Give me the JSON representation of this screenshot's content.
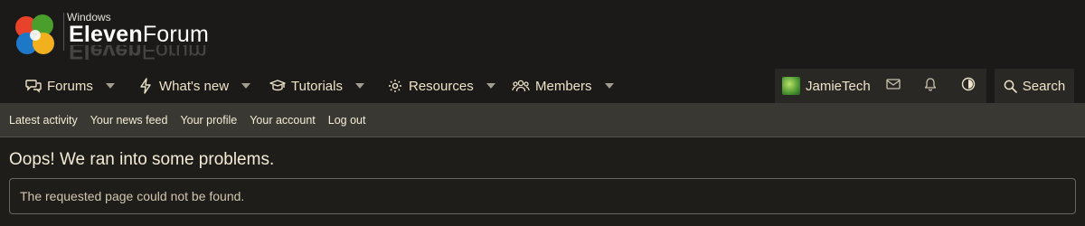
{
  "brand": {
    "pretitle": "Windows",
    "title_bold": "Eleven",
    "title_regular": "Forum"
  },
  "nav": {
    "items": [
      {
        "label": "Forums",
        "icon": "forums-icon"
      },
      {
        "label": "What's new",
        "icon": "bolt-icon"
      },
      {
        "label": "Tutorials",
        "icon": "graduation-cap-icon"
      },
      {
        "label": "Resources",
        "icon": "gear-icon"
      },
      {
        "label": "Members",
        "icon": "members-icon"
      }
    ],
    "user": {
      "name": "JamieTech"
    },
    "search_label": "Search"
  },
  "subnav": {
    "links": [
      "Latest activity",
      "Your news feed",
      "Your profile",
      "Your account",
      "Log out"
    ]
  },
  "main": {
    "title": "Oops! We ran into some problems.",
    "message": "The requested page could not be found."
  },
  "colors": {
    "background": "#1f1d1a",
    "header": "#1b1a18",
    "subnav": "#3a3833",
    "text": "#ede3c8"
  }
}
